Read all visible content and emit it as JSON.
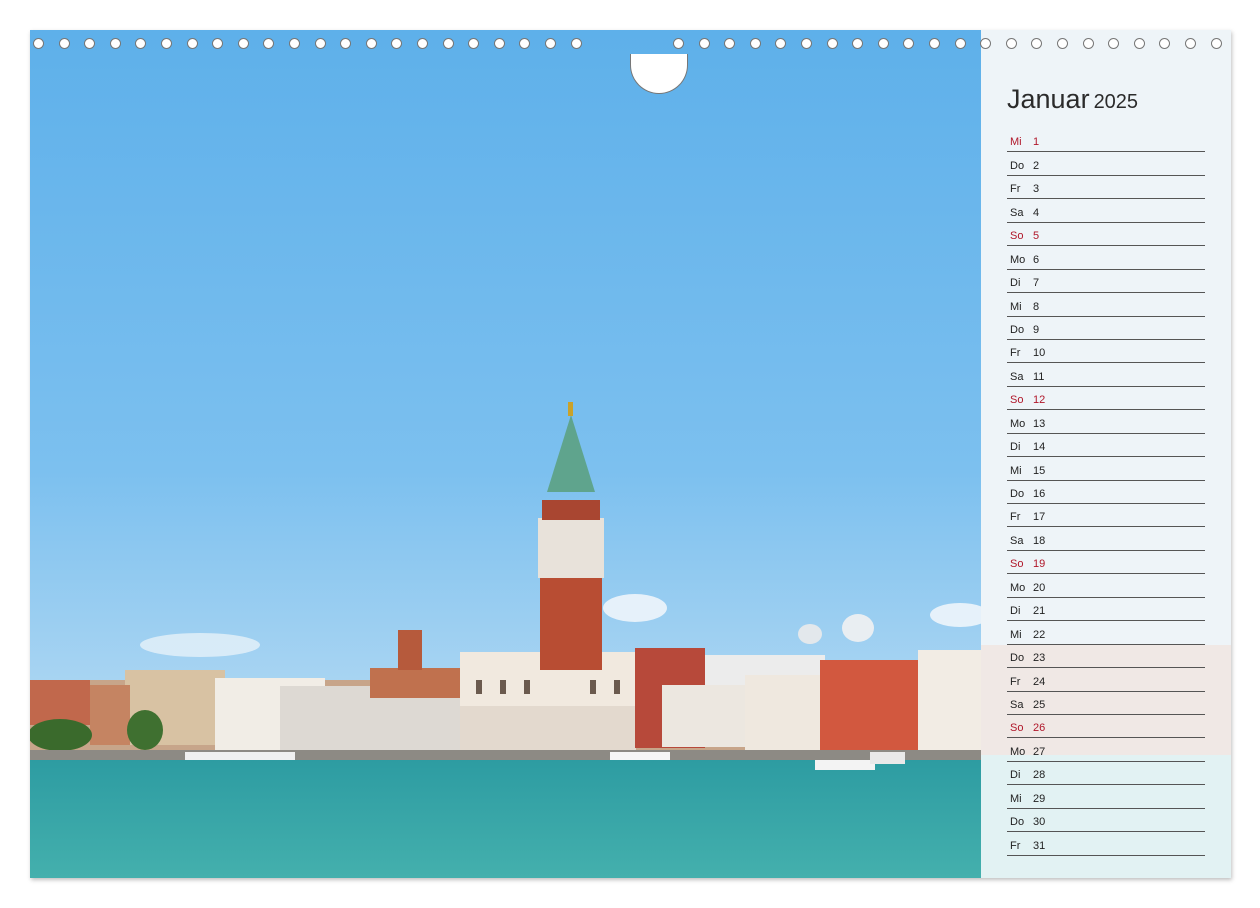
{
  "calendar": {
    "month": "Januar",
    "year": "2025",
    "days": [
      {
        "dn": "Mi",
        "dd": "1",
        "red": true
      },
      {
        "dn": "Do",
        "dd": "2",
        "red": false
      },
      {
        "dn": "Fr",
        "dd": "3",
        "red": false
      },
      {
        "dn": "Sa",
        "dd": "4",
        "red": false
      },
      {
        "dn": "So",
        "dd": "5",
        "red": true
      },
      {
        "dn": "Mo",
        "dd": "6",
        "red": false
      },
      {
        "dn": "Di",
        "dd": "7",
        "red": false
      },
      {
        "dn": "Mi",
        "dd": "8",
        "red": false
      },
      {
        "dn": "Do",
        "dd": "9",
        "red": false
      },
      {
        "dn": "Fr",
        "dd": "10",
        "red": false
      },
      {
        "dn": "Sa",
        "dd": "11",
        "red": false
      },
      {
        "dn": "So",
        "dd": "12",
        "red": true
      },
      {
        "dn": "Mo",
        "dd": "13",
        "red": false
      },
      {
        "dn": "Di",
        "dd": "14",
        "red": false
      },
      {
        "dn": "Mi",
        "dd": "15",
        "red": false
      },
      {
        "dn": "Do",
        "dd": "16",
        "red": false
      },
      {
        "dn": "Fr",
        "dd": "17",
        "red": false
      },
      {
        "dn": "Sa",
        "dd": "18",
        "red": false
      },
      {
        "dn": "So",
        "dd": "19",
        "red": true
      },
      {
        "dn": "Mo",
        "dd": "20",
        "red": false
      },
      {
        "dn": "Di",
        "dd": "21",
        "red": false
      },
      {
        "dn": "Mi",
        "dd": "22",
        "red": false
      },
      {
        "dn": "Do",
        "dd": "23",
        "red": false
      },
      {
        "dn": "Fr",
        "dd": "24",
        "red": false
      },
      {
        "dn": "Sa",
        "dd": "25",
        "red": false
      },
      {
        "dn": "So",
        "dd": "26",
        "red": true
      },
      {
        "dn": "Mo",
        "dd": "27",
        "red": false
      },
      {
        "dn": "Di",
        "dd": "28",
        "red": false
      },
      {
        "dn": "Mi",
        "dd": "29",
        "red": false
      },
      {
        "dn": "Do",
        "dd": "30",
        "red": false
      },
      {
        "dn": "Fr",
        "dd": "31",
        "red": false
      }
    ]
  },
  "colors": {
    "sky": "#6fb6ea",
    "water": "#3aa6a6",
    "holiday_red": "#b0172a"
  }
}
